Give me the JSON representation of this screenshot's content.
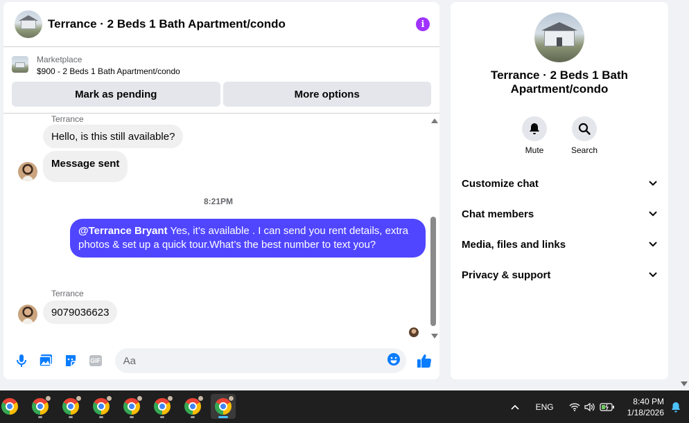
{
  "header": {
    "title": "Terrance · 2 Beds 1 Bath Apartment/condo"
  },
  "marketplace": {
    "label": "Marketplace",
    "item": "$900 - 2 Beds 1 Bath Apartment/condo",
    "buttons": {
      "pending": "Mark as pending",
      "more": "More options"
    }
  },
  "messages": {
    "sender_top": "Terrance",
    "msg1": "Hello, is this still available?",
    "msg2": "Message sent",
    "timestamp": "8:21PM",
    "outgoing_mention": "@Terrance Bryant",
    "outgoing_text": " Yes, it’s available .  I can send you rent details, extra photos & set up a quick tour.What’s the best number to text you?",
    "sender_bottom": "Terrance",
    "msg3": "9079036623"
  },
  "composer": {
    "placeholder": "Aa",
    "gif_label": "GIF"
  },
  "info_panel": {
    "name": "Terrance · 2 Beds 1 Bath Apartment/condo",
    "actions": {
      "mute": "Mute",
      "search": "Search"
    },
    "sections": [
      {
        "label": "Customize chat"
      },
      {
        "label": "Chat members"
      },
      {
        "label": "Media, files and links"
      },
      {
        "label": "Privacy & support"
      }
    ]
  },
  "taskbar": {
    "language": "ENG",
    "time": "8:40 PM",
    "date": "1/18/2026"
  },
  "colors": {
    "accent": "#a033ff",
    "outgoing_bubble": "#5046ff",
    "composer_icons": "#0a7cff"
  }
}
